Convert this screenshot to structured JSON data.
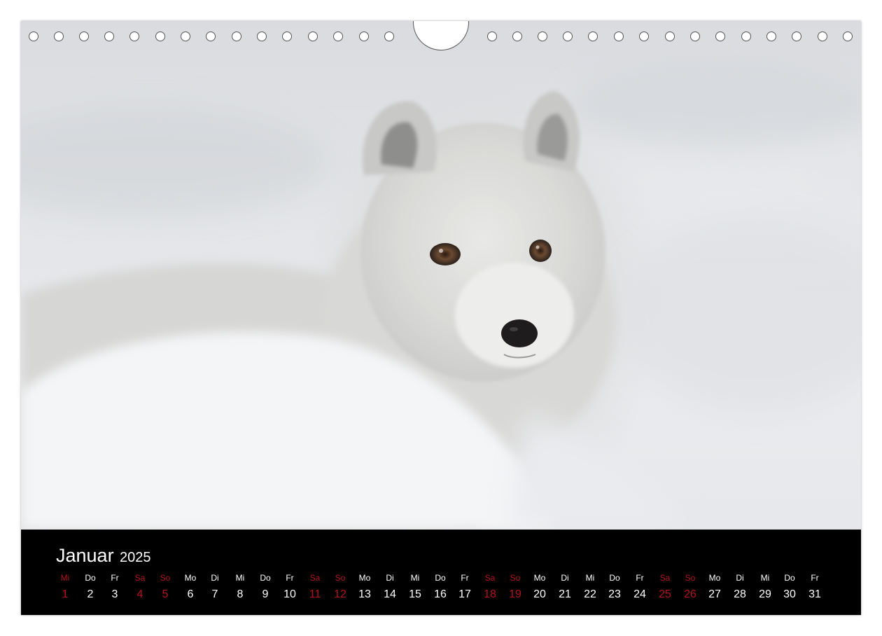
{
  "calendar": {
    "month": "Januar",
    "year": "2025",
    "accent_color": "#b5121b",
    "days": [
      {
        "weekday": "Mi",
        "day": "1",
        "highlight": true
      },
      {
        "weekday": "Do",
        "day": "2",
        "highlight": false
      },
      {
        "weekday": "Fr",
        "day": "3",
        "highlight": false
      },
      {
        "weekday": "Sa",
        "day": "4",
        "highlight": true
      },
      {
        "weekday": "So",
        "day": "5",
        "highlight": true
      },
      {
        "weekday": "Mo",
        "day": "6",
        "highlight": false
      },
      {
        "weekday": "Di",
        "day": "7",
        "highlight": false
      },
      {
        "weekday": "Mi",
        "day": "8",
        "highlight": false
      },
      {
        "weekday": "Do",
        "day": "9",
        "highlight": false
      },
      {
        "weekday": "Fr",
        "day": "10",
        "highlight": false
      },
      {
        "weekday": "Sa",
        "day": "11",
        "highlight": true
      },
      {
        "weekday": "So",
        "day": "12",
        "highlight": true
      },
      {
        "weekday": "Mo",
        "day": "13",
        "highlight": false
      },
      {
        "weekday": "Di",
        "day": "14",
        "highlight": false
      },
      {
        "weekday": "Mi",
        "day": "15",
        "highlight": false
      },
      {
        "weekday": "Do",
        "day": "16",
        "highlight": false
      },
      {
        "weekday": "Fr",
        "day": "17",
        "highlight": false
      },
      {
        "weekday": "Sa",
        "day": "18",
        "highlight": true
      },
      {
        "weekday": "So",
        "day": "19",
        "highlight": true
      },
      {
        "weekday": "Mo",
        "day": "20",
        "highlight": false
      },
      {
        "weekday": "Di",
        "day": "21",
        "highlight": false
      },
      {
        "weekday": "Mi",
        "day": "22",
        "highlight": false
      },
      {
        "weekday": "Do",
        "day": "23",
        "highlight": false
      },
      {
        "weekday": "Fr",
        "day": "24",
        "highlight": false
      },
      {
        "weekday": "Sa",
        "day": "25",
        "highlight": true
      },
      {
        "weekday": "So",
        "day": "26",
        "highlight": true
      },
      {
        "weekday": "Mo",
        "day": "27",
        "highlight": false
      },
      {
        "weekday": "Di",
        "day": "28",
        "highlight": false
      },
      {
        "weekday": "Mi",
        "day": "29",
        "highlight": false
      },
      {
        "weekday": "Do",
        "day": "30",
        "highlight": false
      },
      {
        "weekday": "Fr",
        "day": "31",
        "highlight": false
      }
    ]
  },
  "photo": {
    "subject": "arctic-fox-in-snow"
  }
}
